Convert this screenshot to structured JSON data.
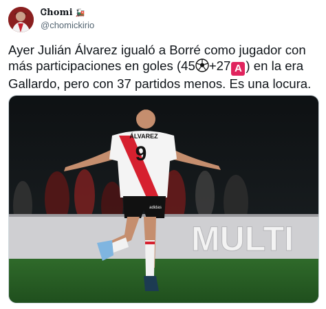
{
  "tweet": {
    "display_name": "Ꮳhomi",
    "name_emoji": "🚂",
    "handle": "@chomickirio",
    "text_part1": "Ayer Julián Álvarez igualó a Borré como jugador con más participaciones en goles (45",
    "goal_emoji": "⚽",
    "text_part2": "+27",
    "assist_badge": "A",
    "text_part3": ") en la era Gallardo, pero con 37 partidos menos. Es una locura."
  },
  "photo": {
    "jersey_name": "ÁLVAREZ",
    "jersey_number": "9",
    "ad_board_text": "MULTI",
    "shorts_logo": "adidas"
  },
  "colors": {
    "handle": "#536471",
    "text": "#0f1419",
    "border": "#cfd9de",
    "assist_badge_bg": "#e0245e",
    "river_red": "#d6202f"
  }
}
